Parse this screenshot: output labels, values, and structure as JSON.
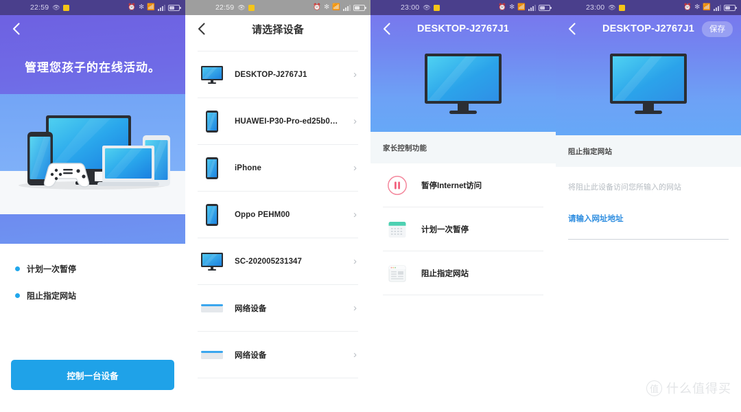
{
  "panels": [
    {
      "statusbar": {
        "time": "22:59",
        "icons": [
          "alarm-icon",
          "bluetooth-icon",
          "wifi-icon",
          "signal-icon",
          "battery-icon"
        ]
      },
      "nav": {
        "back": "‹",
        "title": ""
      },
      "title": "管理您孩子的在线活动。",
      "illustration": "multi-device-illustration",
      "bullets": [
        "计划一次暂停",
        "阻止指定网站"
      ],
      "cta_label": "控制一台设备"
    },
    {
      "statusbar": {
        "time": "22:59"
      },
      "nav": {
        "title": "请选择设备"
      },
      "devices": [
        {
          "name": "DESKTOP-J2767J1",
          "icon": "monitor-icon"
        },
        {
          "name": "HUAWEI-P30-Pro-ed25b0…",
          "icon": "phone-icon"
        },
        {
          "name": "iPhone",
          "icon": "phone-icon"
        },
        {
          "name": "Oppo PEHM00",
          "icon": "phone-icon"
        },
        {
          "name": "SC-202005231347",
          "icon": "monitor-icon"
        },
        {
          "name": "网络设备",
          "icon": "router-icon"
        },
        {
          "name": "网络设备",
          "icon": "router-icon"
        }
      ],
      "chevron": "›"
    },
    {
      "statusbar": {
        "time": "23:00"
      },
      "nav": {
        "title": "DESKTOP-J2767J1"
      },
      "hero_icon": "monitor-icon",
      "section_title": "家长控制功能",
      "features": [
        {
          "label": "暂停Internet访问",
          "icon": "pause-circle-icon"
        },
        {
          "label": "计划一次暂停",
          "icon": "calendar-icon"
        },
        {
          "label": "阻止指定网站",
          "icon": "webpage-icon"
        }
      ]
    },
    {
      "statusbar": {
        "time": "23:00"
      },
      "nav": {
        "title": "DESKTOP-J2767J1",
        "save_label": "保存"
      },
      "hero_icon": "monitor-icon",
      "section_title": "阻止指定网站",
      "hint": "将阻止此设备访问您所输入的网站",
      "input_placeholder": "请输入网址地址",
      "input_value": ""
    }
  ],
  "watermark": {
    "mark": "值",
    "text": "什么值得买"
  },
  "colors": {
    "accent_blue": "#1fa2e8",
    "nav_purple": "#7a72ec",
    "status_dark": "#4a3f8c",
    "status_gray": "#9e9e9e",
    "pause_red": "#f2637f",
    "calendar_green": "#4dd0b1",
    "link_blue": "#2f8ee0"
  }
}
